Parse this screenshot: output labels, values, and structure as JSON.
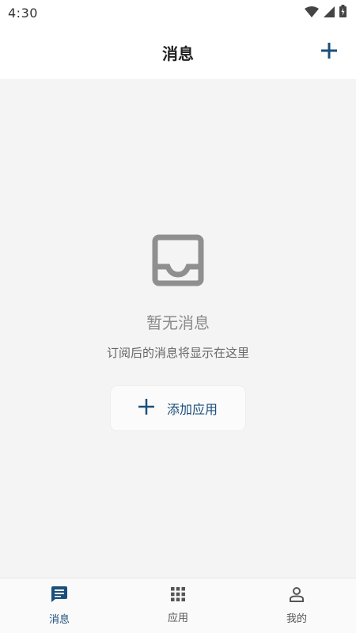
{
  "status_bar": {
    "time": "4:30",
    "icons": [
      "wifi-icon",
      "signal-icon",
      "battery-icon"
    ]
  },
  "header": {
    "title": "消息",
    "add_icon": "plus-icon"
  },
  "empty_state": {
    "icon": "inbox-icon",
    "title": "暂无消息",
    "subtitle": "订阅后的消息将显示在这里",
    "button_label": "添加应用",
    "button_icon": "plus-icon"
  },
  "bottom_nav": {
    "items": [
      {
        "label": "消息",
        "icon": "message-icon",
        "active": true
      },
      {
        "label": "应用",
        "icon": "grid-icon",
        "active": false
      },
      {
        "label": "我的",
        "icon": "person-icon",
        "active": false
      }
    ]
  },
  "colors": {
    "accent": "#1b4f7a",
    "background": "#f4f4f4",
    "icon_gray": "#8f8f8f"
  }
}
